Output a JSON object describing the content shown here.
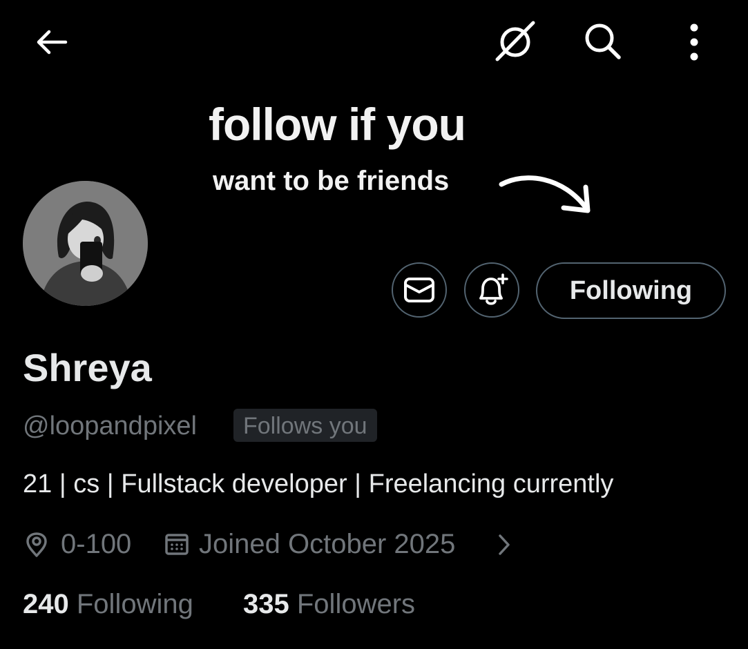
{
  "topbar": {
    "back_icon": "arrow-left-icon",
    "grok_icon": "slashed-circle-icon",
    "search_icon": "search-icon",
    "more_icon": "more-vertical-icon"
  },
  "banner": {
    "line1": "follow if you",
    "line2": "want to be friends",
    "arrow_icon": "curved-arrow-icon"
  },
  "actions": {
    "message_icon": "mail-icon",
    "notify_icon": "bell-plus-icon",
    "following_label": "Following"
  },
  "profile": {
    "name": "Shreya",
    "handle": "@loopandpixel",
    "follows_you": "Follows you",
    "bio": "21 | cs | Fullstack developer | Freelancing currently",
    "location": "0-100",
    "joined": "Joined October 2025",
    "following_count": "240",
    "following_label": "Following",
    "followers_count": "335",
    "followers_label": "Followers"
  },
  "colors": {
    "background": "#000000",
    "text_primary": "#e7e9ea",
    "text_secondary": "#71767b",
    "border": "#536471"
  }
}
